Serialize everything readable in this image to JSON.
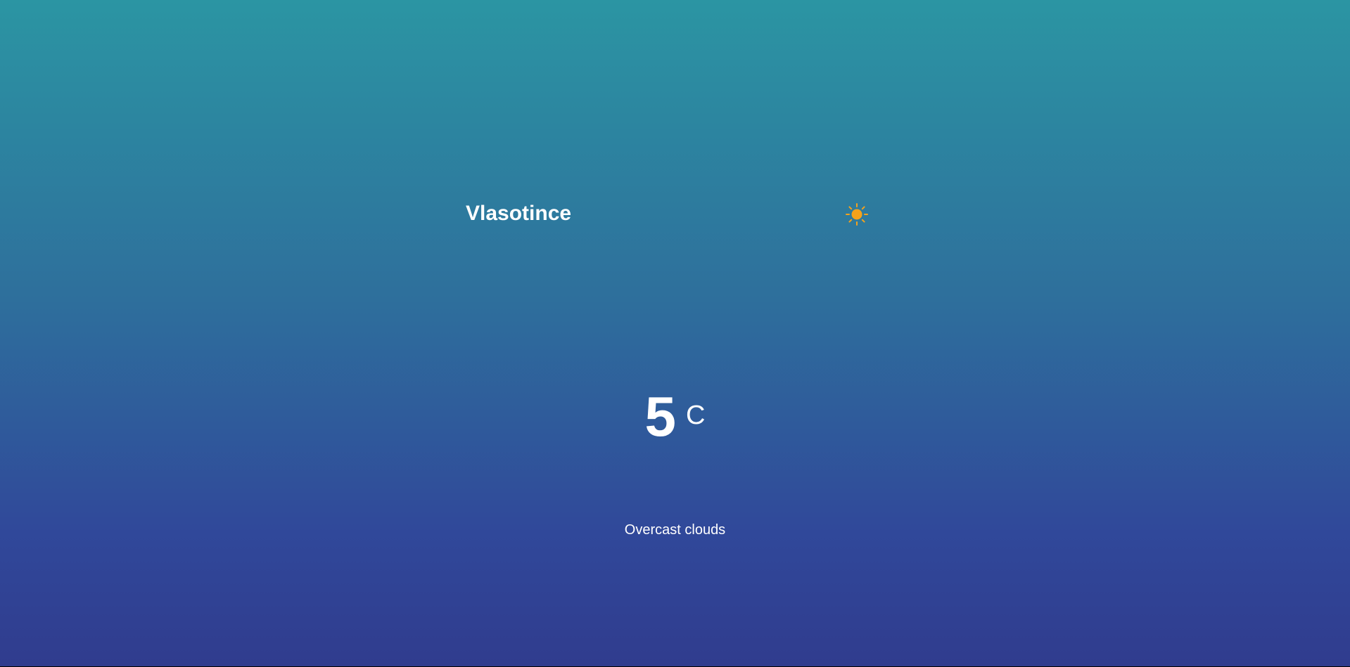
{
  "location": {
    "city": "Vlasotince"
  },
  "current": {
    "icon": "sun-icon",
    "temperature": "5",
    "unit": "C",
    "description": "Overcast clouds"
  },
  "colors": {
    "gradient_top": "#2b95a3",
    "gradient_bottom": "#303c8e",
    "text": "#ffffff",
    "sun": "#f5a21b"
  }
}
